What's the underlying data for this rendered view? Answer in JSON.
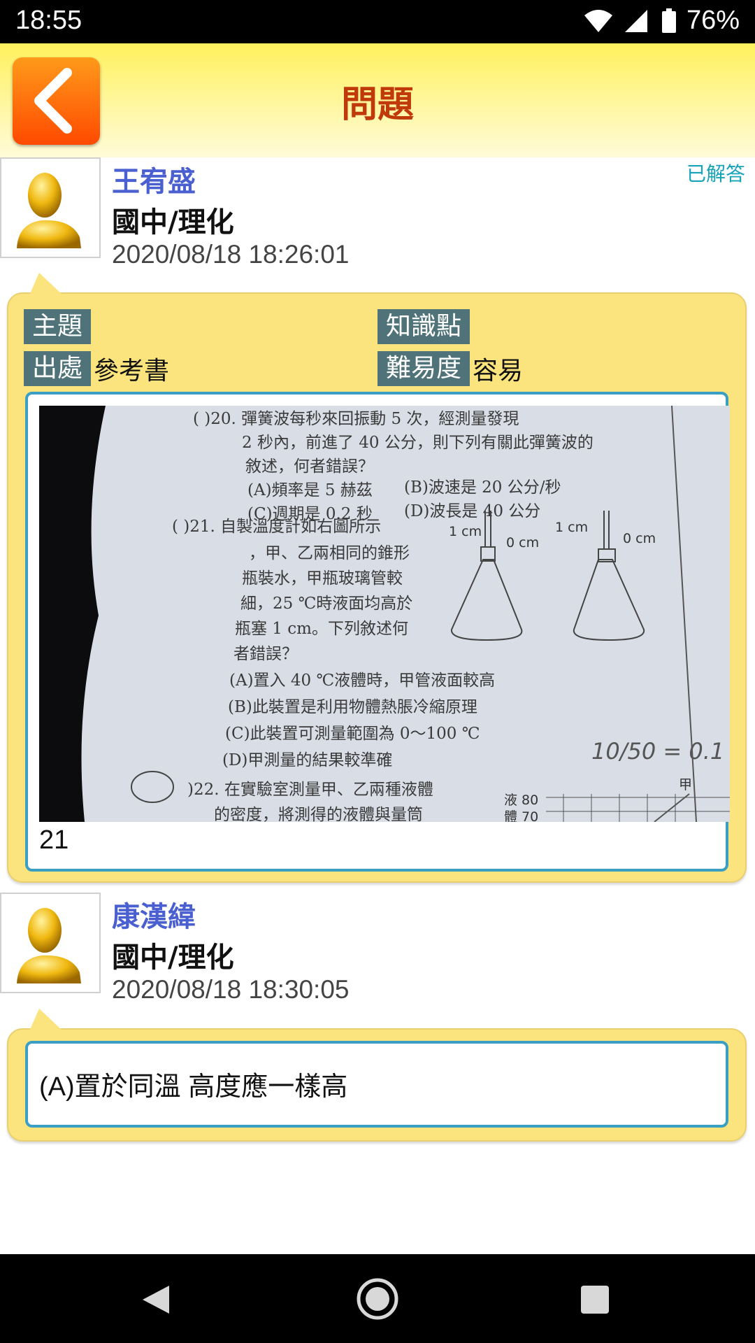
{
  "status_bar": {
    "time": "18:55",
    "battery": "76%"
  },
  "header": {
    "title": "問題"
  },
  "question": {
    "author": "王宥盛",
    "subject": "國中/理化",
    "timestamp": "2020/08/18 18:26:01",
    "status": "已解答",
    "fields": {
      "topic_label": "主題",
      "topic_value": "",
      "knowledge_label": "知識點",
      "knowledge_value": "",
      "source_label": "出處",
      "source_value": "參考書",
      "difficulty_label": "難易度",
      "difficulty_value": "容易"
    },
    "image_text": {
      "q20_line1": "( )20. 彈簧波每秒來回振動 5 次，經測量發現",
      "q20_line2": "2 秒內，前進了 40 公分，則下列有關此彈簧波的",
      "q20_line3": "敘述，何者錯誤？",
      "q20_a": "(A)頻率是 5 赫茲",
      "q20_b": "(B)波速是 20 公分/秒",
      "q20_c": "(C)週期是 0.2 秒",
      "q20_d": "(D)波長是 40 公分",
      "q21_line1": "( )21. 自製溫度計如右圖所示",
      "q21_line2": "，甲、乙兩相同的錐形",
      "q21_line3": "瓶裝水，甲瓶玻璃管較",
      "q21_line4": "細，25 ℃時液面均高於",
      "q21_line5": "瓶塞 1 cm。下列敘述何",
      "q21_line6": "者錯誤？",
      "q21_a": "(A)置入 40 ℃液體時，甲管液面較高",
      "q21_b": "(B)此裝置是利用物體熱脹冷縮原理",
      "q21_c": "(C)此裝置可測量範圍為 0～100 ℃",
      "q21_d": "(D)甲測量的結果較準確",
      "q22_line1": ")22. 在實驗室測量甲、乙兩種液體",
      "q22_line2": "的密度，將測得的液體與量筒",
      "label_1cm_a": "1 cm",
      "label_0cm_a": "0 cm",
      "label_1cm_b": "1 cm",
      "label_0cm_b": "0 cm",
      "graph_80": "液 80",
      "graph_70": "體 70",
      "graph_jia": "甲",
      "handwriting": "10/50 = 0.1"
    },
    "caption": "21"
  },
  "answer": {
    "author": "康漢緯",
    "subject": "國中/理化",
    "timestamp": "2020/08/18 18:30:05",
    "text": "(A)置於同溫 高度應一樣高"
  }
}
